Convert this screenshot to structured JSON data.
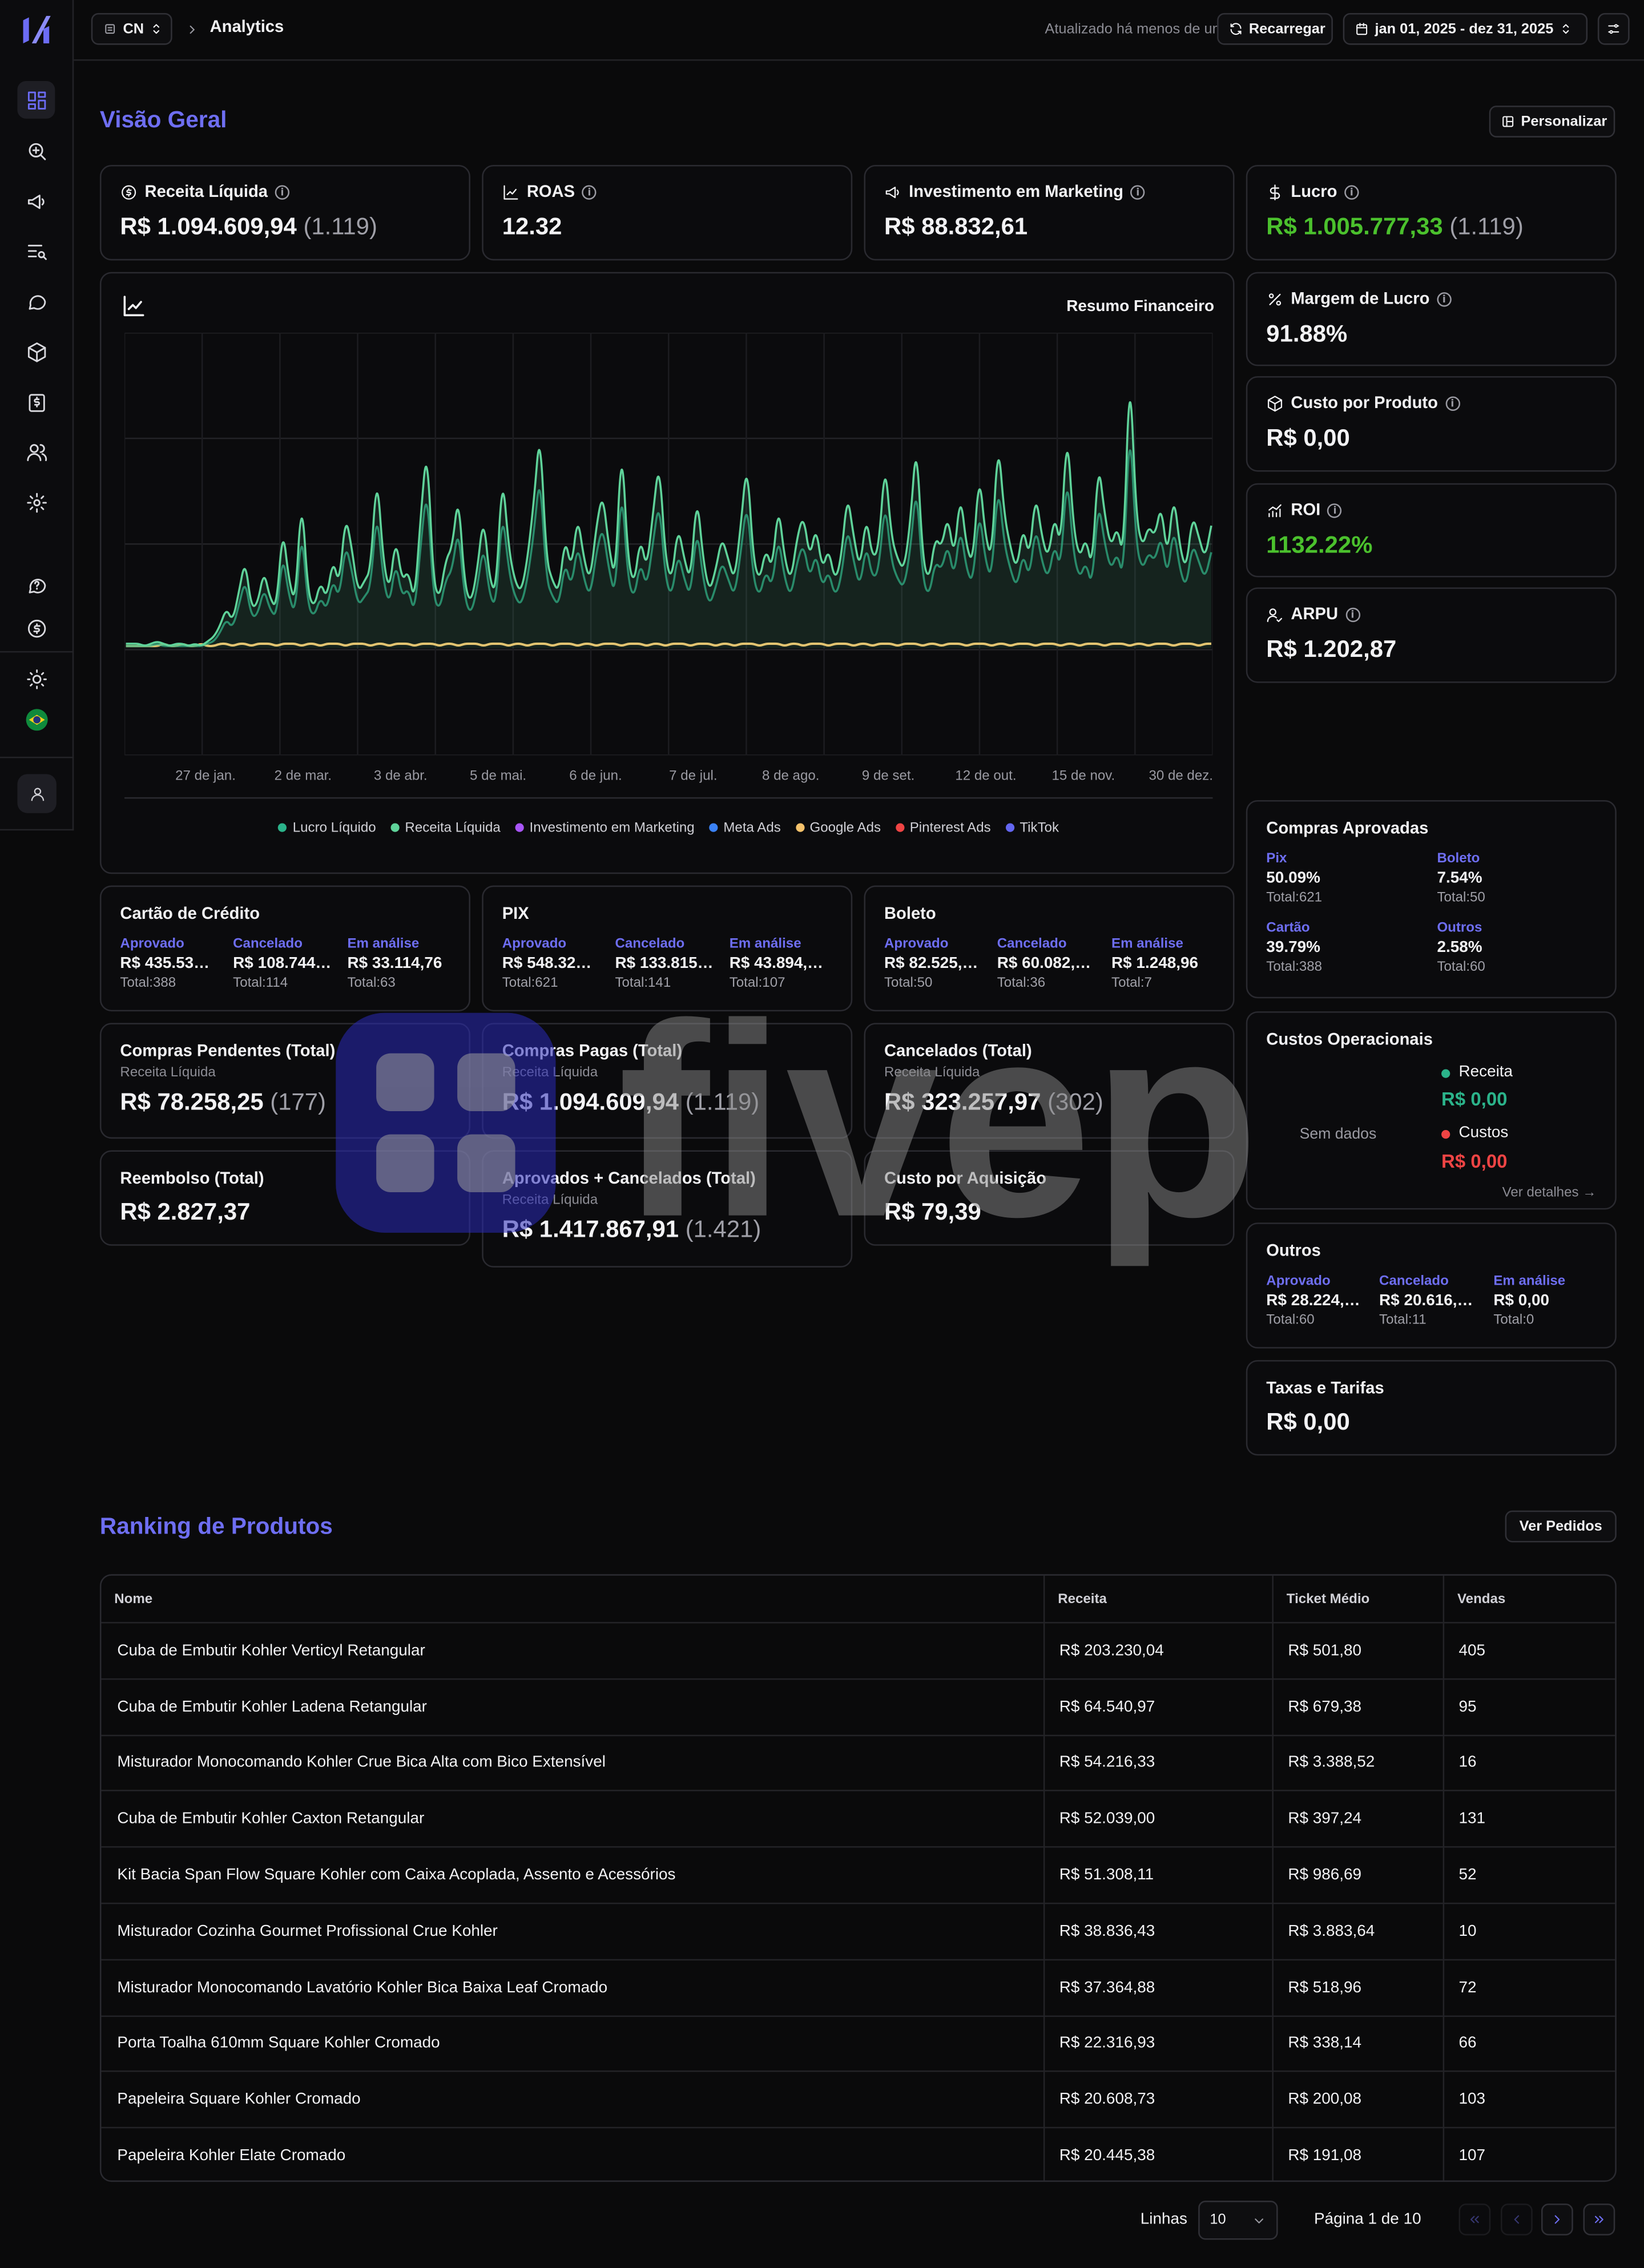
{
  "header": {
    "store": "CN",
    "breadcrumb": "Analytics",
    "updated": "Atualizado há menos de um minuto",
    "reload_label": "Recarregar",
    "date_range": "jan 01, 2025 - dez 31, 2025"
  },
  "overview": {
    "title": "Visão Geral",
    "customize_label": "Personalizar"
  },
  "kpis": {
    "receita": {
      "label": "Receita Líquida",
      "value": "R$ 1.094.609,94",
      "count": "(1.119)"
    },
    "roas": {
      "label": "ROAS",
      "value": "12.32"
    },
    "marketing": {
      "label": "Investimento em Marketing",
      "value": "R$ 88.832,61"
    },
    "lucro": {
      "label": "Lucro",
      "value": "R$ 1.005.777,33",
      "count": "(1.119)"
    },
    "margem": {
      "label": "Margem de Lucro",
      "value": "91.88%"
    },
    "custo_produto": {
      "label": "Custo por Produto",
      "value": "R$ 0,00"
    },
    "roi": {
      "label": "ROI",
      "value": "1132.22%"
    },
    "arpu": {
      "label": "ARPU",
      "value": "R$ 1.202,87"
    }
  },
  "chart_data": {
    "type": "line",
    "title": "Resumo Financeiro",
    "x_ticks": [
      "27 de jan.",
      "2 de mar.",
      "3 de abr.",
      "5 de mai.",
      "6 de jun.",
      "7 de jul.",
      "8 de ago.",
      "9 de set.",
      "12 de out.",
      "15 de nov.",
      "30 de dez."
    ],
    "legend": [
      {
        "name": "Lucro Líquido",
        "color": "#2bb38a"
      },
      {
        "name": "Receita Líquida",
        "color": "#5fd39a"
      },
      {
        "name": "Investimento em Marketing",
        "color": "#a855f7"
      },
      {
        "name": "Meta Ads",
        "color": "#3b82f6"
      },
      {
        "name": "Google Ads",
        "color": "#f5c26b"
      },
      {
        "name": "Pinterest Ads",
        "color": "#ef4444"
      },
      {
        "name": "TikTok",
        "color": "#6366f1"
      }
    ],
    "grid": true,
    "x_range": [
      "2025-01-01",
      "2025-12-31"
    ],
    "series": [
      {
        "name": "Receita Líquida",
        "color": "#5fd39a",
        "values": [
          2,
          2,
          2,
          1,
          2,
          3,
          2,
          1,
          2,
          2,
          1,
          2,
          1,
          3,
          5,
          10,
          18,
          12,
          25,
          40,
          18,
          20,
          35,
          22,
          18,
          55,
          30,
          20,
          70,
          25,
          18,
          30,
          22,
          40,
          28,
          60,
          45,
          25,
          30,
          35,
          80,
          40,
          25,
          50,
          30,
          35,
          20,
          60,
          92,
          30,
          22,
          40,
          45,
          70,
          28,
          20,
          35,
          60,
          30,
          25,
          80,
          45,
          30,
          25,
          40,
          65,
          100,
          40,
          30,
          25,
          50,
          35,
          60,
          40,
          30,
          55,
          70,
          45,
          30,
          95,
          40,
          28,
          50,
          35,
          60,
          85,
          40,
          30,
          55,
          40,
          30,
          70,
          40,
          25,
          35,
          50,
          40,
          30,
          55,
          85,
          40,
          30,
          45,
          35,
          65,
          40,
          30,
          50,
          60,
          40,
          55,
          35,
          45,
          30,
          40,
          70,
          50,
          35,
          60,
          40,
          45,
          85,
          50,
          40,
          35,
          55,
          95,
          40,
          30,
          50,
          45,
          60,
          40,
          70,
          45,
          38,
          80,
          50,
          40,
          95,
          60,
          45,
          35,
          55,
          40,
          70,
          50,
          40,
          60,
          45,
          100,
          55,
          40,
          50,
          35,
          85,
          60,
          45,
          55,
          40,
          130,
          60,
          45,
          55,
          50,
          65,
          40,
          70,
          45,
          35,
          60,
          50,
          40,
          55
        ]
      },
      {
        "name": "Lucro Líquido",
        "color": "#2bb38a",
        "values": [
          1,
          1,
          1,
          1,
          1,
          2,
          1,
          1,
          1,
          1,
          1,
          1,
          1,
          2,
          3,
          7,
          13,
          9,
          19,
          31,
          14,
          15,
          27,
          17,
          14,
          43,
          23,
          15,
          55,
          19,
          14,
          23,
          17,
          31,
          22,
          47,
          35,
          19,
          23,
          27,
          63,
          31,
          19,
          39,
          23,
          27,
          15,
          47,
          73,
          23,
          17,
          31,
          35,
          55,
          22,
          15,
          27,
          47,
          23,
          19,
          63,
          35,
          23,
          19,
          31,
          51,
          80,
          31,
          23,
          19,
          39,
          27,
          47,
          31,
          23,
          43,
          55,
          35,
          23,
          75,
          31,
          22,
          39,
          27,
          47,
          67,
          31,
          23,
          43,
          31,
          23,
          55,
          31,
          19,
          27,
          39,
          31,
          23,
          43,
          67,
          31,
          23,
          35,
          27,
          51,
          31,
          23,
          39,
          47,
          31,
          43,
          27,
          35,
          23,
          31,
          55,
          39,
          27,
          47,
          31,
          35,
          67,
          39,
          31,
          27,
          43,
          75,
          31,
          23,
          39,
          35,
          47,
          31,
          55,
          35,
          29,
          63,
          39,
          31,
          75,
          47,
          35,
          27,
          43,
          31,
          55,
          39,
          31,
          47,
          35,
          80,
          43,
          31,
          39,
          27,
          67,
          47,
          35,
          43,
          31,
          105,
          47,
          35,
          43,
          39,
          51,
          31,
          55,
          35,
          27,
          47,
          39,
          31,
          43
        ]
      },
      {
        "name": "Google Ads",
        "color": "#f5c26b",
        "values": [
          1,
          1,
          1,
          1,
          1,
          1,
          2,
          1,
          1,
          2,
          1,
          1,
          2,
          1,
          1,
          2,
          2,
          1,
          2,
          2,
          1,
          2,
          2,
          2,
          1,
          2,
          2,
          2,
          1,
          2,
          2,
          1,
          2,
          2,
          2,
          1,
          2,
          2,
          2,
          1,
          2,
          2,
          1,
          2,
          2,
          2,
          1,
          2,
          2,
          2,
          1,
          2,
          2,
          1,
          2,
          2,
          2,
          1,
          2,
          2,
          2,
          1,
          2,
          2,
          1,
          2,
          2,
          2,
          1,
          2,
          2,
          2,
          1,
          2,
          2,
          1,
          2,
          2,
          2,
          1,
          2,
          2,
          2,
          1,
          2,
          2,
          1,
          2,
          2,
          2,
          1,
          2,
          2,
          2,
          1,
          2,
          2,
          1,
          2,
          2,
          2,
          1,
          2,
          2,
          2,
          1,
          2,
          2,
          1,
          2,
          2,
          2,
          1,
          2,
          2,
          2,
          1,
          2,
          2,
          1,
          2,
          2,
          2,
          1,
          2,
          2,
          2,
          1,
          2,
          2,
          1,
          2,
          2,
          2,
          1,
          2,
          2,
          2,
          1,
          2,
          2,
          1,
          2,
          2,
          2,
          1,
          2,
          2,
          2,
          1,
          2,
          2,
          1,
          2,
          2,
          2,
          1,
          2,
          2,
          2,
          1,
          2,
          2,
          1,
          2,
          2,
          2,
          1,
          2,
          2,
          2,
          1,
          2,
          2
        ]
      }
    ]
  },
  "payments": {
    "credito": {
      "title": "Cartão de Crédito",
      "cols": [
        {
          "h": "Aprovado",
          "v": "R$ 435.53…",
          "t": "Total:388"
        },
        {
          "h": "Cancelado",
          "v": "R$ 108.744…",
          "t": "Total:114"
        },
        {
          "h": "Em análise",
          "v": "R$ 33.114,76",
          "t": "Total:63"
        }
      ]
    },
    "pix": {
      "title": "PIX",
      "cols": [
        {
          "h": "Aprovado",
          "v": "R$ 548.32…",
          "t": "Total:621"
        },
        {
          "h": "Cancelado",
          "v": "R$ 133.815…",
          "t": "Total:141"
        },
        {
          "h": "Em análise",
          "v": "R$ 43.894,…",
          "t": "Total:107"
        }
      ]
    },
    "boleto": {
      "title": "Boleto",
      "cols": [
        {
          "h": "Aprovado",
          "v": "R$ 82.525,…",
          "t": "Total:50"
        },
        {
          "h": "Cancelado",
          "v": "R$ 60.082,…",
          "t": "Total:36"
        },
        {
          "h": "Em análise",
          "v": "R$ 1.248,96",
          "t": "Total:7"
        }
      ]
    }
  },
  "totals": {
    "pendentes": {
      "title": "Compras Pendentes (Total)",
      "sub": "Receita Líquida",
      "value": "R$ 78.258,25",
      "count": "(177)"
    },
    "pagas": {
      "title": "Compras Pagas (Total)",
      "sub": "Receita Líquida",
      "value": "R$ 1.094.609,94",
      "count": "(1.119)"
    },
    "cancelados": {
      "title": "Cancelados (Total)",
      "sub": "Receita Líquida",
      "value": "R$ 323.257,97",
      "count": "(302)"
    },
    "reembolso": {
      "title": "Reembolso (Total)",
      "value": "R$ 2.827,37"
    },
    "aprov_cancel": {
      "title": "Aprovados + Cancelados (Total)",
      "sub": "Receita Líquida",
      "value": "R$ 1.417.867,91",
      "count": "(1.421)"
    },
    "cac": {
      "title": "Custo por Aquisição",
      "value": "R$ 79,39"
    }
  },
  "compras_aprovadas": {
    "title": "Compras Aprovadas",
    "items": [
      {
        "h": "Pix",
        "pct": "50.09%",
        "t": "Total:621"
      },
      {
        "h": "Boleto",
        "pct": "7.54%",
        "t": "Total:50"
      },
      {
        "h": "Cartão",
        "pct": "39.79%",
        "t": "Total:388"
      },
      {
        "h": "Outros",
        "pct": "2.58%",
        "t": "Total:60"
      }
    ]
  },
  "custos": {
    "title": "Custos Operacionais",
    "empty": "Sem dados",
    "receita_label": "Receita",
    "receita_value": "R$ 0,00",
    "custos_label": "Custos",
    "custos_value": "R$ 0,00",
    "details": "Ver detalhes"
  },
  "outros": {
    "title": "Outros",
    "cols": [
      {
        "h": "Aprovado",
        "v": "R$ 28.224,…",
        "t": "Total:60"
      },
      {
        "h": "Cancelado",
        "v": "R$ 20.616,…",
        "t": "Total:11"
      },
      {
        "h": "Em análise",
        "v": "R$ 0,00",
        "t": "Total:0"
      }
    ]
  },
  "taxas": {
    "title": "Taxas e Tarifas",
    "value": "R$ 0,00"
  },
  "ranking": {
    "title": "Ranking de Produtos",
    "orders_label": "Ver Pedidos",
    "headers": [
      "Nome",
      "Receita",
      "Ticket Médio",
      "Vendas"
    ],
    "rows": [
      [
        "Cuba de Embutir Kohler Verticyl Retangular",
        "R$ 203.230,04",
        "R$ 501,80",
        "405"
      ],
      [
        "Cuba de Embutir Kohler Ladena Retangular",
        "R$ 64.540,97",
        "R$ 679,38",
        "95"
      ],
      [
        "Misturador Monocomando Kohler Crue Bica Alta com Bico Extensível",
        "R$ 54.216,33",
        "R$ 3.388,52",
        "16"
      ],
      [
        "Cuba de Embutir Kohler Caxton Retangular",
        "R$ 52.039,00",
        "R$ 397,24",
        "131"
      ],
      [
        "Kit Bacia Span Flow Square Kohler com Caixa Acoplada, Assento e Acessórios",
        "R$ 51.308,11",
        "R$ 986,69",
        "52"
      ],
      [
        "Misturador Cozinha Gourmet Profissional Crue Kohler",
        "R$ 38.836,43",
        "R$ 3.883,64",
        "10"
      ],
      [
        "Misturador Monocomando Lavatório Kohler Bica Baixa Leaf Cromado",
        "R$ 37.364,88",
        "R$ 518,96",
        "72"
      ],
      [
        "Porta Toalha 610mm Square Kohler Cromado",
        "R$ 22.316,93",
        "R$ 338,14",
        "66"
      ],
      [
        "Papeleira Square Kohler Cromado",
        "R$ 20.608,73",
        "R$ 200,08",
        "103"
      ],
      [
        "Papeleira Kohler Elate Cromado",
        "R$ 20.445,38",
        "R$ 191,08",
        "107"
      ]
    ]
  },
  "pagination": {
    "rows_label": "Linhas",
    "rows_value": "10",
    "page_text": "Página 1 de 10"
  },
  "watermark": {
    "text": "fivep"
  },
  "colors": {
    "accent": "#6e6ef2",
    "positive": "#4bc12d",
    "teal": "#2bb38a",
    "danger": "#ef4444"
  }
}
